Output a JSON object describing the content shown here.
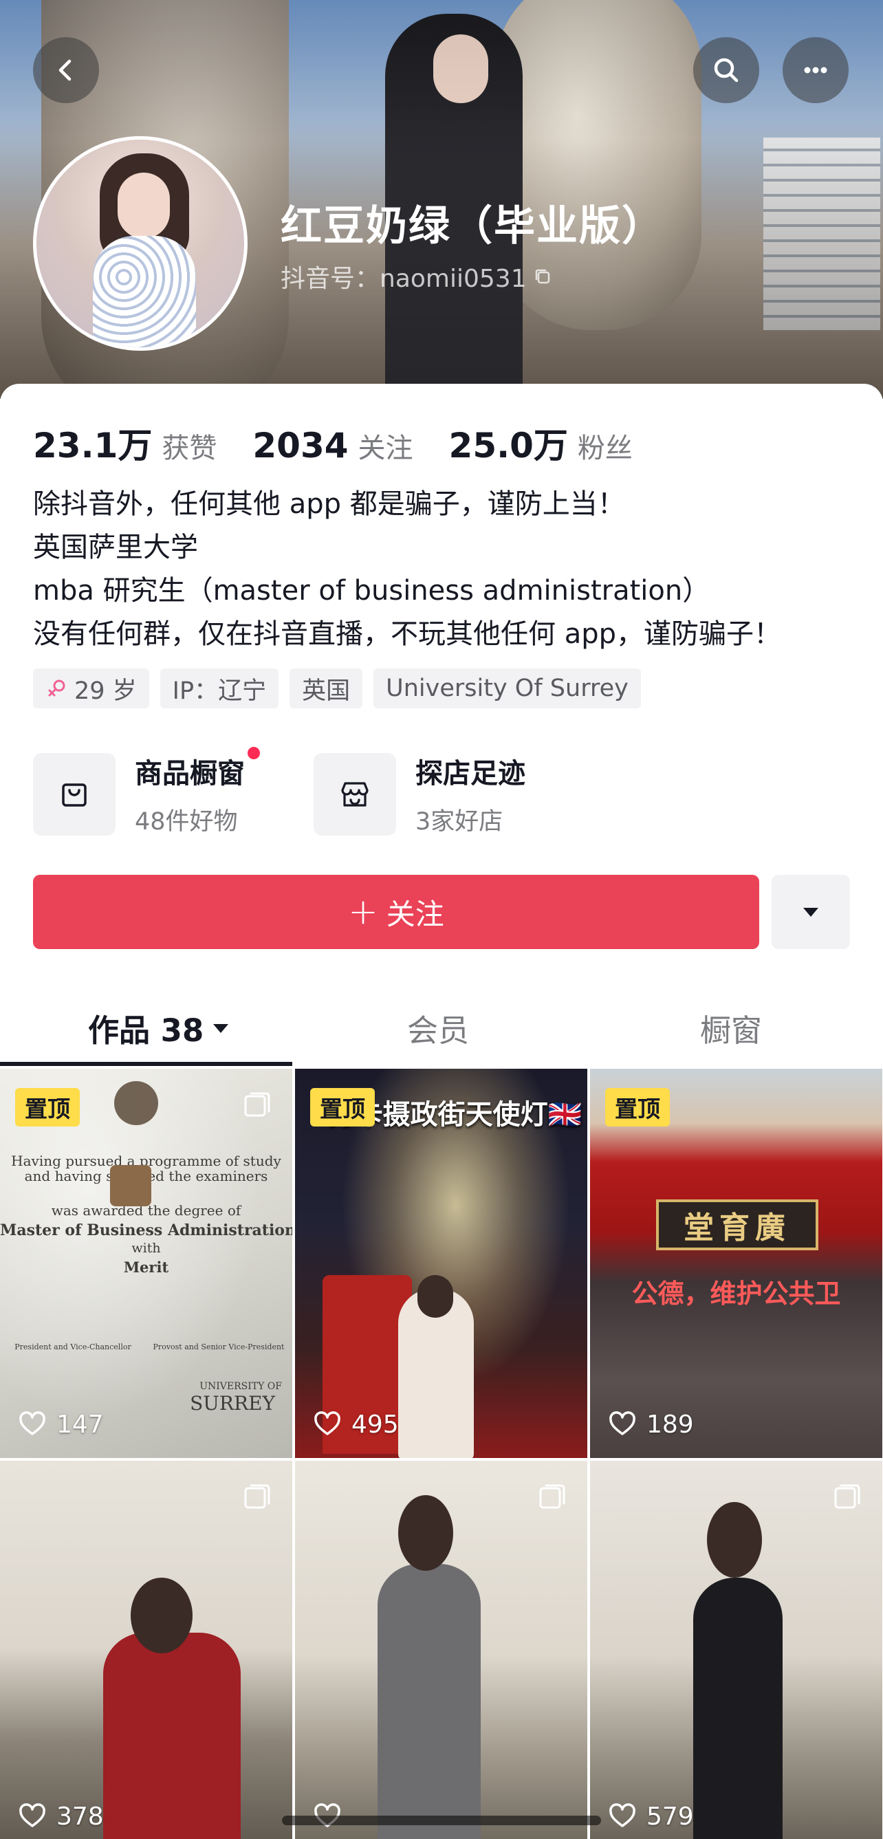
{
  "header": {
    "nickname": "红豆奶绿（毕业版）",
    "douyin_id": "抖音号：naomii0531"
  },
  "stats": {
    "likes_num": "23.1万",
    "likes_label": "获赞",
    "following_num": "2034",
    "following_label": "关注",
    "followers_num": "25.0万",
    "followers_label": "粉丝"
  },
  "bio": {
    "lines": [
      "除抖音外，任何其他 app 都是骗子，谨防上当！",
      "英国萨里大学",
      "mba 研究生（master of business administration）",
      "没有任何群，仅在抖音直播，不玩其他任何 app，谨防骗子！"
    ]
  },
  "tags": {
    "age": "29 岁",
    "ip": "IP：辽宁",
    "country": "英国",
    "school": "University Of Surrey"
  },
  "shortcuts": {
    "shop_title": "商品橱窗",
    "shop_sub": "48件好物",
    "visits_title": "探店足迹",
    "visits_sub": "3家好店"
  },
  "actions": {
    "follow_label": "关注"
  },
  "tabs": {
    "works_label": "作品 38",
    "member_label": "会员",
    "window_label": "橱窗"
  },
  "grid": {
    "pinned_label": "置顶",
    "items": [
      {
        "likes": "147"
      },
      {
        "likes": "495",
        "title": "打卡摄政街天使灯🇬🇧"
      },
      {
        "likes": "189",
        "sign": "堂育廣",
        "banner": "公德，维护公共卫"
      },
      {
        "likes": "378"
      },
      {
        "likes": ""
      },
      {
        "likes": "579"
      }
    ],
    "certificate": {
      "line1": "Having pursued a programme of study",
      "line2": "and having satisfied the examiners",
      "line3": "was awarded the degree of",
      "degree": "Master of Business Administration",
      "with": "with",
      "merit": "Merit",
      "sig_left": "President and Vice-Chancellor",
      "sig_right": "Provost and Senior Vice-President",
      "university_of": "UNIVERSITY OF",
      "surrey": "SURREY"
    }
  },
  "colors": {
    "accent_red": "#ea4257",
    "pin_yellow": "#fedc4a",
    "notification_dot": "#fe2c55",
    "female_icon": "#f06292"
  },
  "icons": {
    "back": "chevron-left-icon",
    "search": "search-icon",
    "more": "more-dots-icon",
    "copy": "copy-icon",
    "gender": "female-icon",
    "shop": "shopping-bag-icon",
    "store": "store-icon",
    "dropdown": "triangle-down-icon",
    "like": "heart-icon",
    "multi": "multi-image-icon"
  }
}
